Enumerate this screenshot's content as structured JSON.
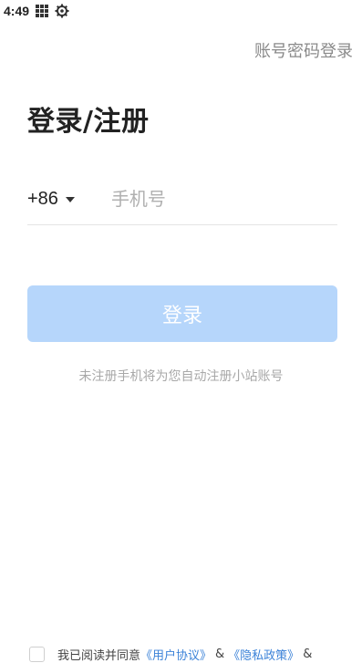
{
  "status_bar": {
    "time": "4:49",
    "icons": [
      "grid-icon",
      "gear-icon"
    ]
  },
  "header": {
    "account_password_login": "账号密码登录"
  },
  "main": {
    "title": "登录/注册",
    "country_code": "+86",
    "phone_placeholder": "手机号",
    "login_button": "登录",
    "hint": "未注册手机将为您自动注册小站账号"
  },
  "agreement": {
    "prefix": "我已阅读并同意",
    "user_agreement": "《用户协议》",
    "separator": "&",
    "privacy_policy": "《隐私政策》",
    "suffix": "&"
  },
  "colors": {
    "button_disabled": "#b6d6fb",
    "link": "#3b82d8",
    "hint": "#a8a8a8"
  }
}
